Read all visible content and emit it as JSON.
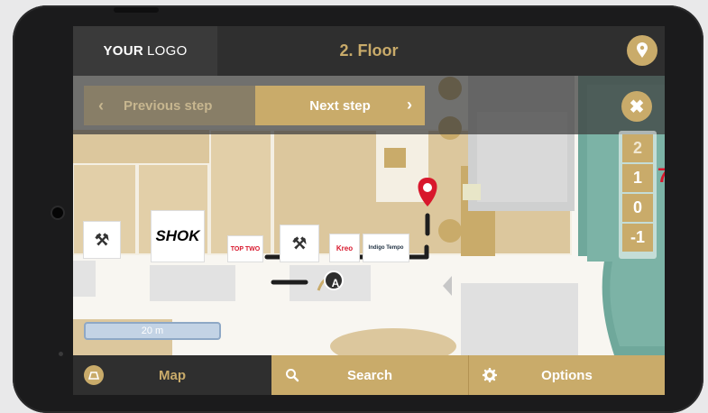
{
  "header": {
    "logo_bold": "YOUR",
    "logo_light": "LOGO",
    "floor_title": "2. Floor",
    "location_icon": "map-pin-icon"
  },
  "route_nav": {
    "previous_label": "Previous step",
    "next_label": "Next step",
    "close_icon": "close-icon"
  },
  "floors": [
    "2",
    "1",
    "0",
    "-1"
  ],
  "current_floor": "2",
  "map": {
    "scale_label": "20 m",
    "shops": [
      "SHOK",
      "TOP TWO",
      "Kreo",
      "Indigo Tempo"
    ],
    "marker_letter": "A"
  },
  "bottom_tabs": [
    {
      "label": "Map",
      "icon": "map-icon"
    },
    {
      "label": "Search",
      "icon": "search-icon"
    },
    {
      "label": "Options",
      "icon": "gear-icon"
    }
  ],
  "colors": {
    "accent": "#c9ab6a",
    "dark": "#2f2f2f",
    "route_pin": "#d8172c"
  }
}
